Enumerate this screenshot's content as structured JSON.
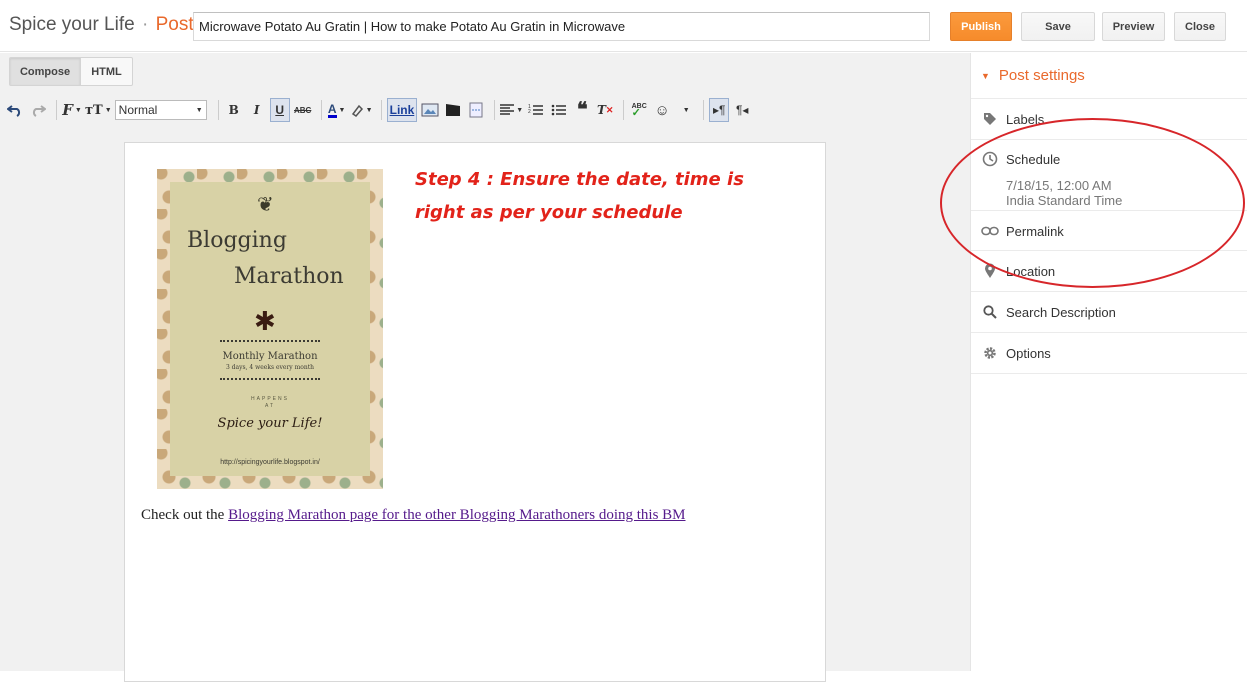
{
  "header": {
    "brand": "Spice your Life",
    "separator": "·",
    "section": "Post",
    "post_title": "Microwave Potato Au Gratin | How to make Potato Au Gratin in Microwave",
    "publish_label": "Publish",
    "save_label": "Save",
    "preview_label": "Preview",
    "close_label": "Close",
    "publish_color": "#f68b2b"
  },
  "mode_tabs": {
    "compose": "Compose",
    "html": "HTML",
    "active": "compose"
  },
  "toolbar": {
    "font_size_value": "Normal",
    "link_label": "Link",
    "icons": [
      "undo-icon",
      "redo-icon",
      "font-family-icon",
      "font-size-icon",
      "bold-icon",
      "italic-icon",
      "underline-icon",
      "strikethrough-icon",
      "text-color-icon",
      "highlight-icon",
      "link",
      "image-icon",
      "video-icon",
      "jump-break-icon",
      "align-icon",
      "numbered-list-icon",
      "bullet-list-icon",
      "quote-icon",
      "remove-formatting-icon",
      "spellcheck-icon",
      "emoticon-icon",
      "ltr-icon",
      "rtl-icon"
    ]
  },
  "content": {
    "image": {
      "title_line1": "Blogging",
      "title_line2": "Marathon",
      "monthly": "Monthly Marathon",
      "days": "3 days, 4 weeks every month",
      "happens": "HAPPENS",
      "at": "AT",
      "spice": "Spice your Life!",
      "url": "http://spicingyourlife.blogspot.in/"
    },
    "step_note": "Step 4 : Ensure the date, time is right as per your schedule",
    "body_prefix": "Check out the ",
    "body_link": "Blogging Marathon page for the other Blogging Marathoners doing this BM"
  },
  "sidebar": {
    "heading": "Post settings",
    "accent_color": "#e9692c",
    "items": [
      {
        "label": "Labels",
        "icon": "tag-icon"
      },
      {
        "label": "Schedule",
        "icon": "clock-icon",
        "detail_date": "7/18/15, 12:00 AM",
        "detail_tz": "India Standard Time"
      },
      {
        "label": "Permalink",
        "icon": "link-icon"
      },
      {
        "label": "Location",
        "icon": "location-pin-icon"
      },
      {
        "label": "Search Description",
        "icon": "search-icon"
      },
      {
        "label": "Options",
        "icon": "gear-icon"
      }
    ]
  },
  "annotation_color": "#d7262a"
}
